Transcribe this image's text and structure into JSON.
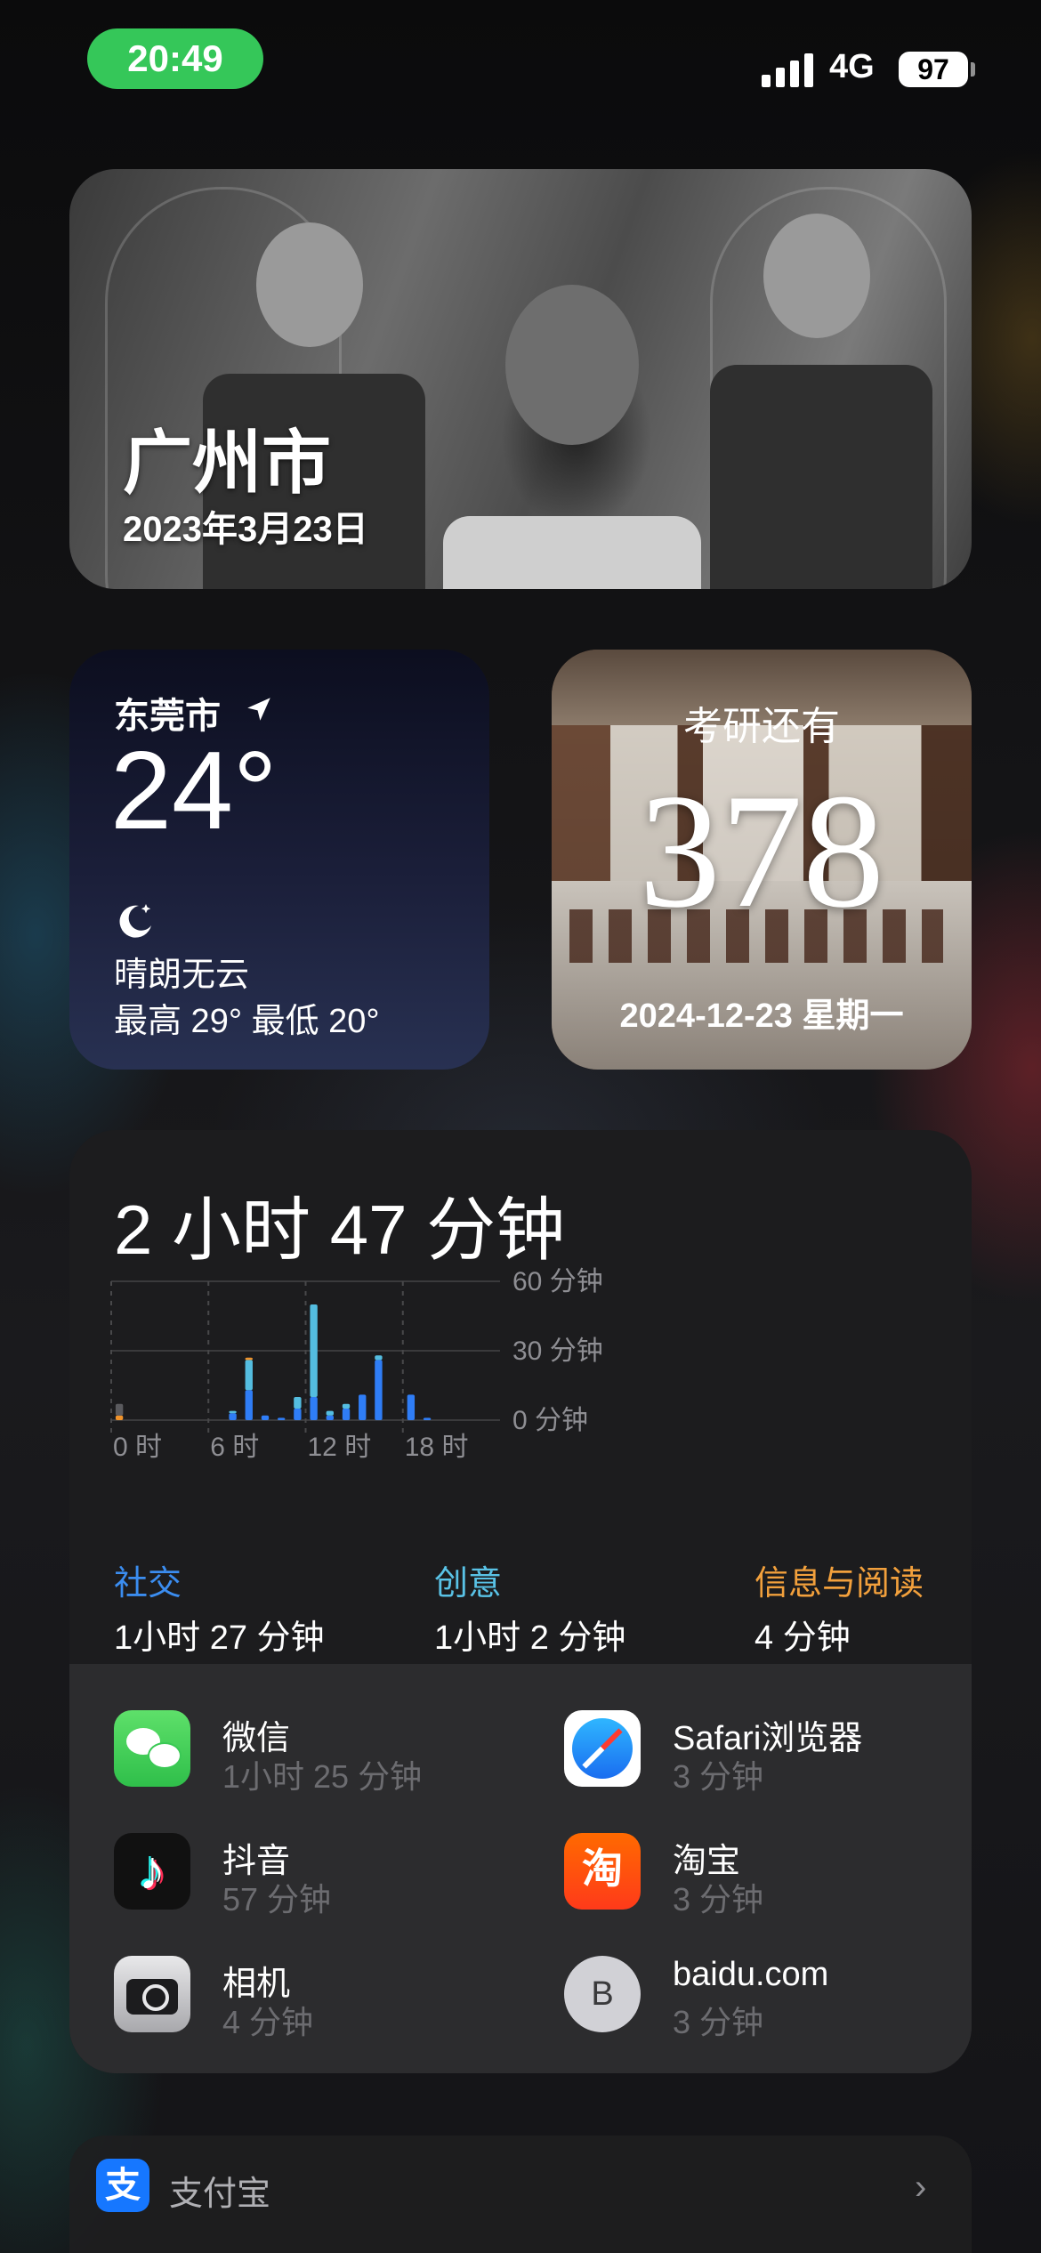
{
  "status_bar": {
    "time": "20:49",
    "network": "4G",
    "battery": "97"
  },
  "photo_widget": {
    "city": "广州市",
    "date": "2023年3月23日"
  },
  "weather_widget": {
    "city": "东莞市",
    "temperature": "24°",
    "condition": "晴朗无云",
    "range": "最高 29° 最低 20°",
    "icons": [
      "location-arrow-icon",
      "moon-stars-icon"
    ]
  },
  "countdown_widget": {
    "title": "考研还有",
    "days": "378",
    "date": "2024-12-23 星期一"
  },
  "screen_time": {
    "total": "2 小时 47 分钟",
    "chart_data": {
      "type": "bar",
      "x": [
        "0时",
        "1时",
        "2时",
        "3时",
        "4时",
        "5时",
        "6时",
        "7时",
        "8时",
        "9时",
        "10时",
        "11时",
        "12时",
        "13时",
        "14时",
        "15时",
        "16时",
        "17时",
        "18时",
        "19时",
        "20时",
        "21时",
        "22时",
        "23时"
      ],
      "x_tick_labels": [
        "0 时",
        "6 时",
        "12 时",
        "18 时"
      ],
      "y_tick_labels": [
        "60 分钟",
        "30 分钟",
        "0 分钟"
      ],
      "ylim": [
        0,
        60
      ],
      "series": [
        {
          "name": "社交",
          "color": "#2f7df6",
          "values": [
            0,
            0,
            0,
            0,
            0,
            0,
            0,
            3,
            13,
            2,
            1,
            5,
            10,
            2,
            5,
            11,
            26,
            0,
            11,
            1,
            0,
            0,
            0,
            0
          ]
        },
        {
          "name": "创意",
          "color": "#54bde0",
          "values": [
            0,
            0,
            0,
            0,
            0,
            0,
            0,
            1,
            13,
            0,
            0,
            5,
            40,
            2,
            2,
            0,
            2,
            0,
            0,
            0,
            0,
            0,
            0,
            0
          ]
        },
        {
          "name": "信息与阅读",
          "color": "#f0932b",
          "values": [
            2,
            0,
            0,
            0,
            0,
            0,
            0,
            0,
            1,
            0,
            0,
            0,
            0,
            0,
            0,
            0,
            0,
            0,
            0,
            0,
            0,
            0,
            0,
            0
          ]
        },
        {
          "name": "",
          "color": "#5a5a5e",
          "values": [
            5,
            0,
            0,
            0,
            0,
            0,
            0,
            0,
            0,
            0,
            0,
            0,
            0,
            0,
            0,
            0,
            0,
            0,
            0,
            0,
            0,
            0,
            0,
            0
          ]
        }
      ]
    },
    "categories": [
      {
        "name": "社交",
        "time": "1小时 27 分钟",
        "color": "#3b8df0"
      },
      {
        "name": "创意",
        "time": "1小时 2 分钟",
        "color": "#59c2e6"
      },
      {
        "name": "信息与阅读",
        "time": "4 分钟",
        "color": "#f2a03c"
      }
    ],
    "apps": [
      {
        "name": "微信",
        "time": "1小时 25 分钟",
        "icon": "wechat-icon"
      },
      {
        "name": "Safari浏览器",
        "time": "3 分钟",
        "icon": "safari-compass-icon"
      },
      {
        "name": "抖音",
        "time": "57 分钟",
        "icon": "douyin-icon"
      },
      {
        "name": "淘宝",
        "time": "3 分钟",
        "icon": "taobao-icon"
      },
      {
        "name": "相机",
        "time": "4 分钟",
        "icon": "camera-icon"
      },
      {
        "name": "baidu.com",
        "time": "3 分钟",
        "icon": "letter-b-icon",
        "letter": "B"
      }
    ]
  },
  "alipay": {
    "name": "支付宝",
    "icon_char": "支"
  }
}
